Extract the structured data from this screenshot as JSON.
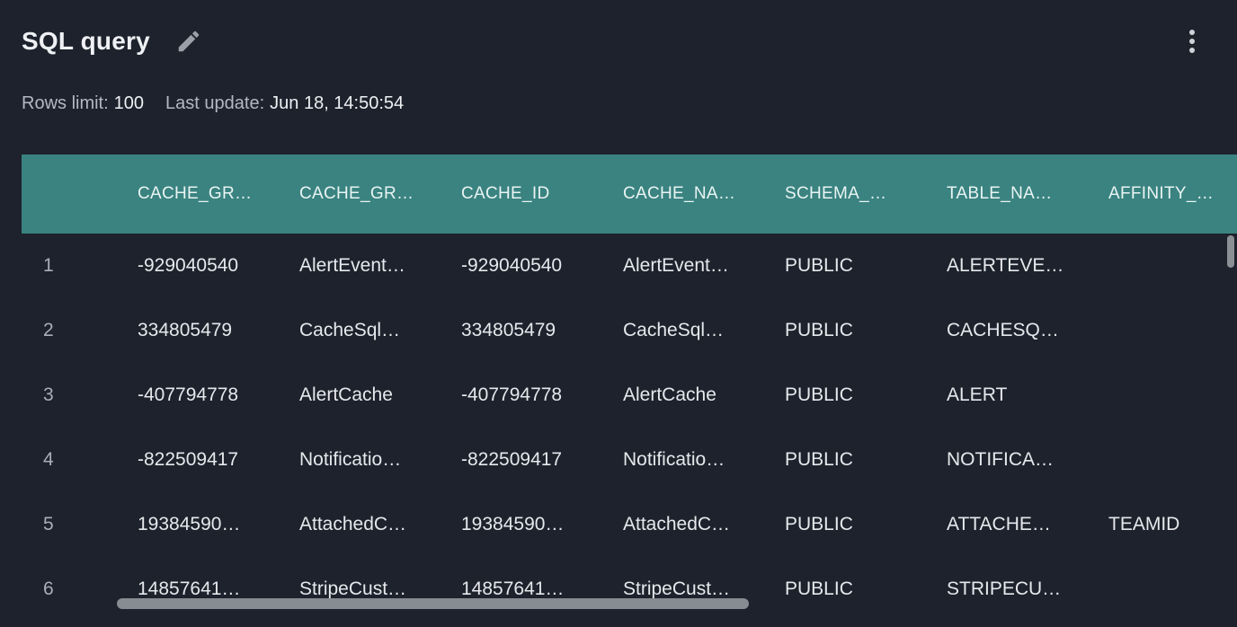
{
  "header": {
    "title": "SQL query",
    "edit_icon": "pencil-icon",
    "more_icon": "more-vertical-icon"
  },
  "meta": {
    "rows_limit_label": "Rows limit:",
    "rows_limit_value": "100",
    "last_update_label": "Last update:",
    "last_update_value": "Jun 18, 14:50:54"
  },
  "table": {
    "columns": [
      "",
      "CACHE_GR…",
      "CACHE_GR…",
      "CACHE_ID",
      "CACHE_NA…",
      "SCHEMA_…",
      "TABLE_NA…",
      "AFFINITY_…"
    ],
    "rows": [
      [
        "1",
        "-929040540",
        "AlertEvent…",
        "-929040540",
        "AlertEvent…",
        "PUBLIC",
        "ALERTEVE…",
        ""
      ],
      [
        "2",
        "334805479",
        "CacheSql…",
        "334805479",
        "CacheSql…",
        "PUBLIC",
        "CACHESQ…",
        ""
      ],
      [
        "3",
        "-407794778",
        "AlertCache",
        "-407794778",
        "AlertCache",
        "PUBLIC",
        "ALERT",
        ""
      ],
      [
        "4",
        "-822509417",
        "Notificatio…",
        "-822509417",
        "Notificatio…",
        "PUBLIC",
        "NOTIFICA…",
        ""
      ],
      [
        "5",
        "19384590…",
        "AttachedC…",
        "19384590…",
        "AttachedC…",
        "PUBLIC",
        "ATTACHE…",
        "TEAMID"
      ],
      [
        "6",
        "14857641…",
        "StripeCust…",
        "14857641…",
        "StripeCust…",
        "PUBLIC",
        "STRIPECU…",
        ""
      ]
    ]
  },
  "colors": {
    "background": "#1d222c",
    "header_row": "#3a8380",
    "scrollbar": "#878b92"
  }
}
